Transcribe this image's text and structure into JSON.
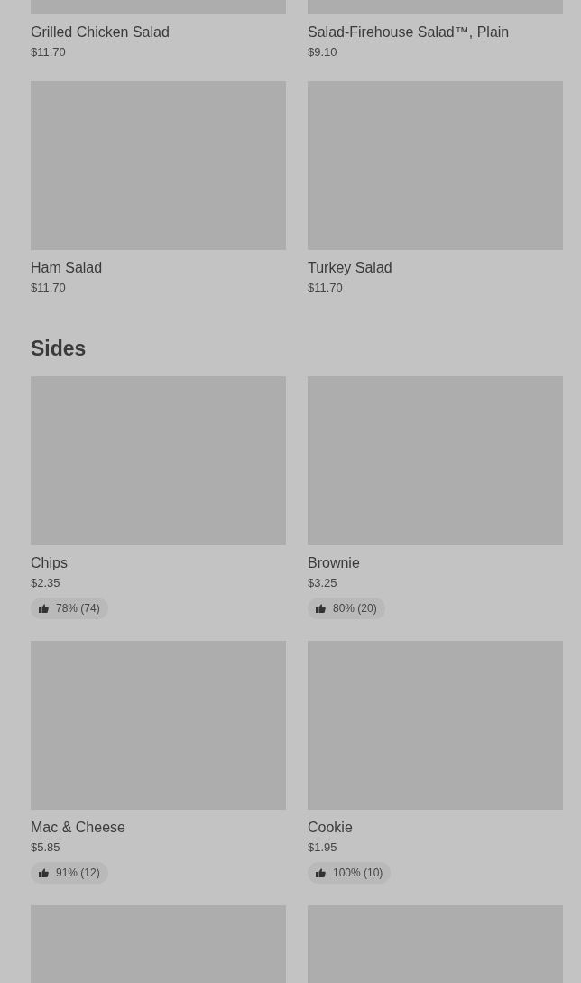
{
  "sections": [
    {
      "items": [
        {
          "kind": "dish",
          "name": "Grilled Chicken Salad",
          "price": "$11.70"
        },
        {
          "kind": "dish",
          "name": "Salad-Firehouse Salad™, Plain",
          "price": "$9.10"
        },
        {
          "kind": "dish",
          "name": "Ham Salad",
          "price": "$11.70"
        },
        {
          "kind": "dish",
          "name": "Turkey Salad",
          "price": "$11.70"
        }
      ]
    },
    {
      "title": "Sides",
      "items": [
        {
          "kind": "dish",
          "name": "Chips",
          "price": "$2.35",
          "rating": "78% (74)"
        },
        {
          "kind": "dish",
          "name": "Brownie",
          "price": "$3.25",
          "rating": "80% (20)"
        },
        {
          "kind": "dish",
          "name": "Mac & Cheese",
          "price": "$5.85",
          "rating": "91% (12)"
        },
        {
          "kind": "dish",
          "name": "Cookie",
          "price": "$1.95",
          "rating": "100% (10)"
        },
        {
          "kind": "image_only"
        },
        {
          "kind": "image_only"
        }
      ]
    }
  ]
}
